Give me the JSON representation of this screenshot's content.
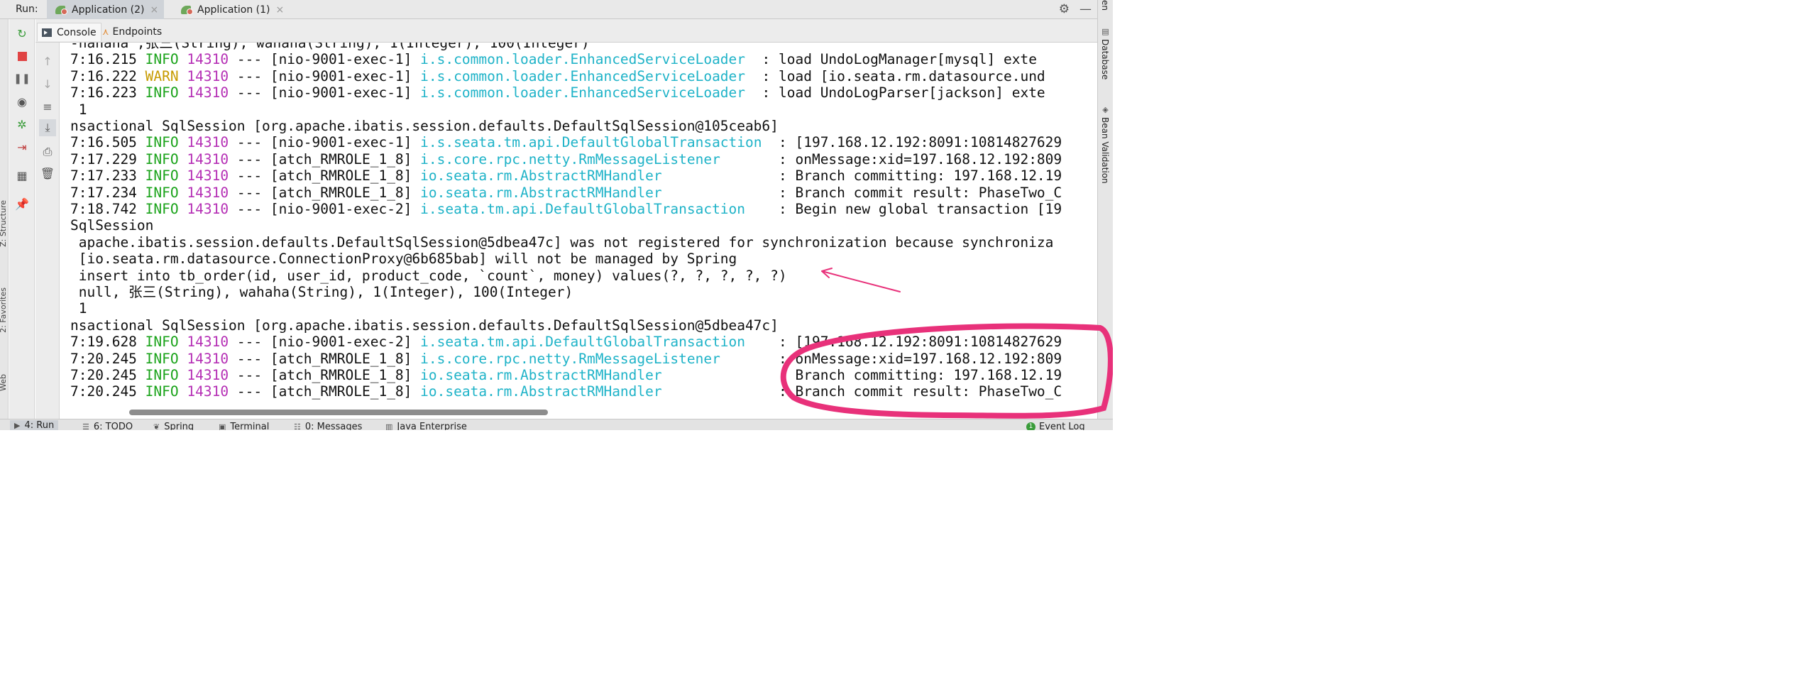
{
  "run": {
    "label": "Run:",
    "tabs": [
      {
        "label": "Application (2)",
        "active": true
      },
      {
        "label": "Application (1)",
        "active": false
      }
    ],
    "close_glyph": "×"
  },
  "subtabs": [
    {
      "label": "Console",
      "active": true,
      "icon": "console-icon"
    },
    {
      "label": "Endpoints",
      "active": false,
      "icon": "endpoints-icon"
    }
  ],
  "right_sidebar": [
    {
      "label": "en",
      "icon": ""
    },
    {
      "label": "Database",
      "icon": "database-icon"
    },
    {
      "label": "Bean Validation",
      "icon": "bean-validation-icon"
    }
  ],
  "left_sidebar": [
    {
      "label": "Z: Structure"
    },
    {
      "label": "2: Favorites"
    },
    {
      "label": "Web"
    }
  ],
  "log_lines": [
    {
      "kind": "plain",
      "text": "-hahaha ,张三(String), wahaha(String), 1(Integer), 100(Integer)"
    },
    {
      "kind": "log",
      "time": "7:16.215",
      "level": "INFO",
      "pid": "14310",
      "sep": "---",
      "thread": "[nio-9001-exec-1]",
      "logger": "i.s.common.loader.EnhancedServiceLoader  ",
      "msg": ": load UndoLogManager[mysql] exte"
    },
    {
      "kind": "log",
      "time": "7:16.222",
      "level": "WARN",
      "pid": "14310",
      "sep": "---",
      "thread": "[nio-9001-exec-1]",
      "logger": "i.s.common.loader.EnhancedServiceLoader  ",
      "msg": ": load [io.seata.rm.datasource.und"
    },
    {
      "kind": "log",
      "time": "7:16.223",
      "level": "INFO",
      "pid": "14310",
      "sep": "---",
      "thread": "[nio-9001-exec-1]",
      "logger": "i.s.common.loader.EnhancedServiceLoader  ",
      "msg": ": load UndoLogParser[jackson] exte"
    },
    {
      "kind": "plain",
      "text": " 1"
    },
    {
      "kind": "plain",
      "text": "nsactional SqlSession [org.apache.ibatis.session.defaults.DefaultSqlSession@105ceab6]"
    },
    {
      "kind": "log",
      "time": "7:16.505",
      "level": "INFO",
      "pid": "14310",
      "sep": "---",
      "thread": "[nio-9001-exec-1]",
      "logger": "i.s.seata.tm.api.DefaultGlobalTransaction",
      "msg": "  : [197.168.12.192:8091:10814827629"
    },
    {
      "kind": "log",
      "time": "7:17.229",
      "level": "INFO",
      "pid": "14310",
      "sep": "---",
      "thread": "[atch_RMROLE_1_8]",
      "logger": "i.s.core.rpc.netty.RmMessageListener     ",
      "msg": "  : onMessage:xid=197.168.12.192:809"
    },
    {
      "kind": "log",
      "time": "7:17.233",
      "level": "INFO",
      "pid": "14310",
      "sep": "---",
      "thread": "[atch_RMROLE_1_8]",
      "logger": "io.seata.rm.AbstractRMHandler            ",
      "msg": "  : Branch committing: 197.168.12.19"
    },
    {
      "kind": "log",
      "time": "7:17.234",
      "level": "INFO",
      "pid": "14310",
      "sep": "---",
      "thread": "[atch_RMROLE_1_8]",
      "logger": "io.seata.rm.AbstractRMHandler            ",
      "msg": "  : Branch commit result: PhaseTwo_C"
    },
    {
      "kind": "log",
      "time": "7:18.742",
      "level": "INFO",
      "pid": "14310",
      "sep": "---",
      "thread": "[nio-9001-exec-2]",
      "logger": "i.seata.tm.api.DefaultGlobalTransaction  ",
      "msg": "  : Begin new global transaction [19"
    },
    {
      "kind": "plain",
      "text": "SqlSession"
    },
    {
      "kind": "plain",
      "text": " apache.ibatis.session.defaults.DefaultSqlSession@5dbea47c] was not registered for synchronization because synchroniza"
    },
    {
      "kind": "plain",
      "text": " [io.seata.rm.datasource.ConnectionProxy@6b685bab] will not be managed by Spring"
    },
    {
      "kind": "plain",
      "text": " insert into tb_order(id, user_id, product_code, `count`, money) values(?, ?, ?, ?, ?)"
    },
    {
      "kind": "plain",
      "text": " null, 张三(String), wahaha(String), 1(Integer), 100(Integer)"
    },
    {
      "kind": "plain",
      "text": " 1"
    },
    {
      "kind": "plain",
      "text": "nsactional SqlSession [org.apache.ibatis.session.defaults.DefaultSqlSession@5dbea47c]"
    },
    {
      "kind": "log",
      "time": "7:19.628",
      "level": "INFO",
      "pid": "14310",
      "sep": "---",
      "thread": "[nio-9001-exec-2]",
      "logger": "i.seata.tm.api.DefaultGlobalTransaction  ",
      "msg": "  : [197.168.12.192:8091:10814827629"
    },
    {
      "kind": "log",
      "time": "7:20.245",
      "level": "INFO",
      "pid": "14310",
      "sep": "---",
      "thread": "[atch_RMROLE_1_8]",
      "logger": "i.s.core.rpc.netty.RmMessageListener     ",
      "msg": "  : onMessage:xid=197.168.12.192:809"
    },
    {
      "kind": "log",
      "time": "7:20.245",
      "level": "INFO",
      "pid": "14310",
      "sep": "---",
      "thread": "[atch_RMROLE_1_8]",
      "logger": "io.seata.rm.AbstractRMHandler            ",
      "msg": "  : Branch committing: 197.168.12.19"
    },
    {
      "kind": "log",
      "time": "7:20.245",
      "level": "INFO",
      "pid": "14310",
      "sep": "---",
      "thread": "[atch_RMROLE_1_8]",
      "logger": "io.seata.rm.AbstractRMHandler            ",
      "msg": "  : Branch commit result: PhaseTwo_C"
    }
  ],
  "bottom_tabs": [
    {
      "label": "4: Run",
      "active": true,
      "icon": "run-icon"
    },
    {
      "label": "6: TODO",
      "active": false,
      "icon": "todo-icon"
    },
    {
      "label": "Spring",
      "active": false,
      "icon": "spring-icon"
    },
    {
      "label": "Terminal",
      "active": false,
      "icon": "terminal-icon"
    },
    {
      "label": "0: Messages",
      "active": false,
      "icon": "messages-icon"
    },
    {
      "label": "Java Enterprise",
      "active": false,
      "icon": "java-enterprise-icon"
    }
  ],
  "event_log": {
    "label": "Event Log",
    "count": "1"
  },
  "colors": {
    "info": "#1aa31a",
    "warn": "#c79b00",
    "pid": "#b52fb5",
    "logger": "#1fb3c8",
    "annotation": "#e8317a"
  }
}
